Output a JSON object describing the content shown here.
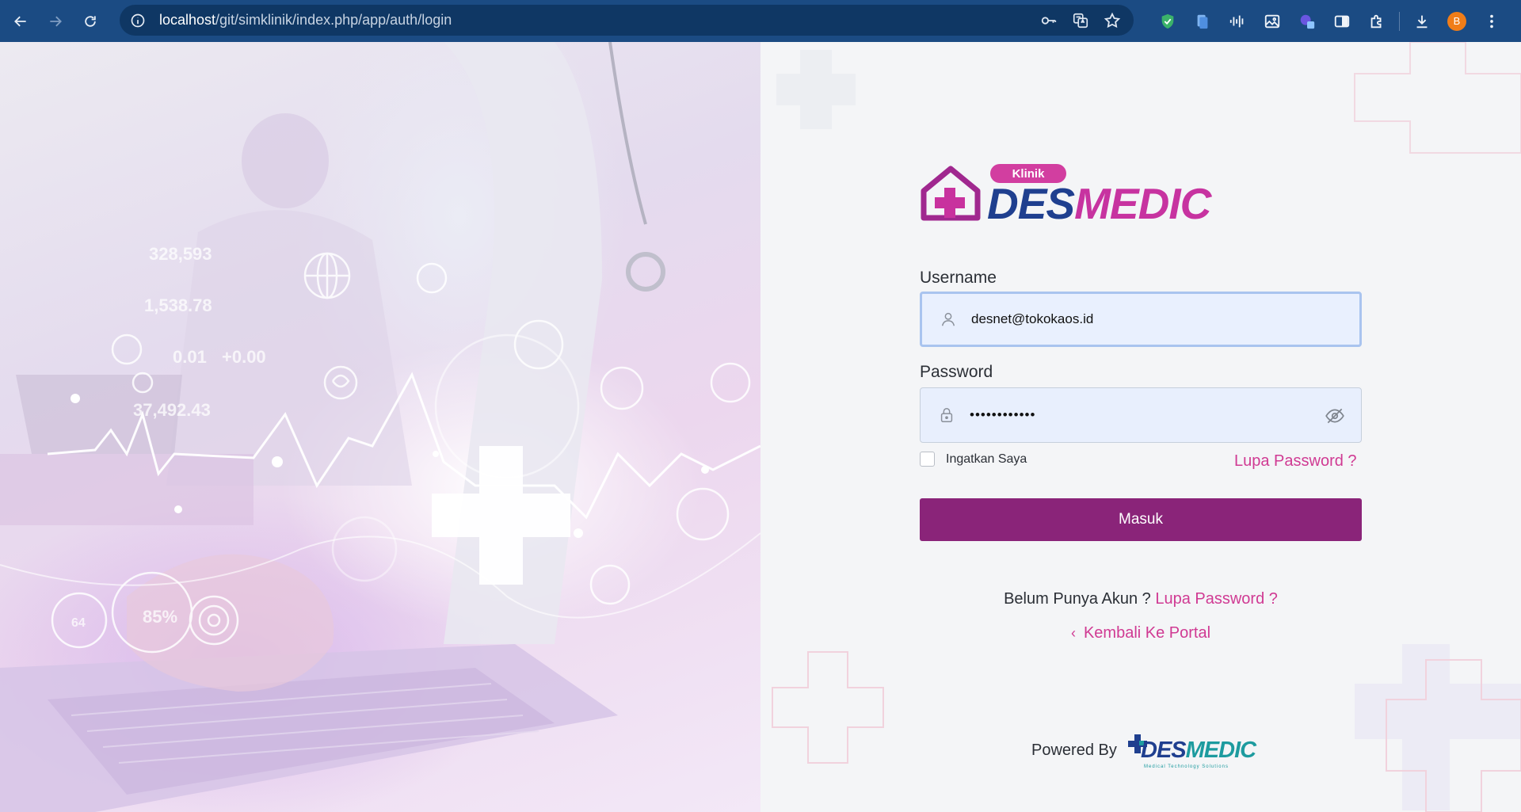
{
  "browser": {
    "url_host": "localhost",
    "url_path": "/git/simklinik/index.php/app/auth/login",
    "profile_initial": "B"
  },
  "logo": {
    "badge": "Klinik",
    "word_part1": "DES",
    "word_part2": "MEDIC"
  },
  "form": {
    "username_label": "Username",
    "username_value": "desnet@tokokaos.id",
    "password_label": "Password",
    "password_masked": "••••••••••••",
    "remember_label": "Ingatkan Saya",
    "forgot_link": "Lupa Password ?",
    "submit_label": "Masuk"
  },
  "footer_links": {
    "no_account_text": "Belum Punya Akun ?",
    "no_account_link": "Lupa Password ?",
    "back_link": "Kembali Ke Portal"
  },
  "powered": {
    "label": "Powered By",
    "brand_part1": "DES",
    "brand_part2": "MEDIC",
    "brand_tagline": "Medical Technology Solutions"
  },
  "hero_numbers": [
    "328,593",
    "1,538.78",
    "0.01",
    "+0.00",
    "37,492.43",
    "85%",
    "64"
  ],
  "colors": {
    "chrome": "#1b4b83",
    "primary_button": "#8a2479",
    "link_pink": "#d03a93",
    "brand_blue": "#1f3f8f",
    "brand_magenta": "#c733a0"
  }
}
